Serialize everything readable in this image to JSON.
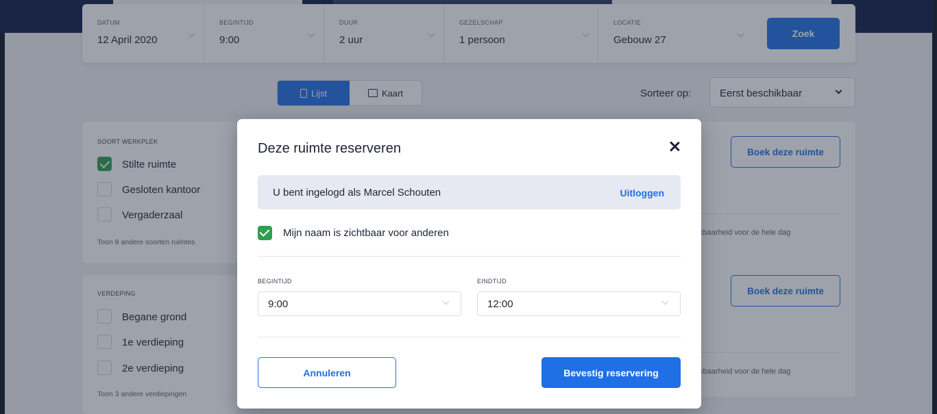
{
  "search": {
    "fields": [
      {
        "label": "DATUM",
        "value": "12 April 2020"
      },
      {
        "label": "BEGINTIJD",
        "value": "9:00"
      },
      {
        "label": "DUUR",
        "value": "2 uur"
      },
      {
        "label": "GEZELSCHAP",
        "value": "1 persoon"
      },
      {
        "label": "LOCATIE",
        "value": "Gebouw 27"
      }
    ],
    "submit_label": "Zoek"
  },
  "view_toggle": {
    "list_label": "Lijst",
    "map_label": "Kaart"
  },
  "sort": {
    "label": "Sorteer op:",
    "value": "Eerst beschikbaar"
  },
  "filters": {
    "workplace": {
      "title": "SOORT WERKPLEK",
      "items": [
        {
          "label": "Stilte ruimte",
          "checked": true
        },
        {
          "label": "Gesloten kantoor",
          "checked": false
        },
        {
          "label": "Vergaderzaal",
          "checked": false
        }
      ],
      "more": "Toon 8 andere soorten ruimtes"
    },
    "floor": {
      "title": "VERDEPING",
      "items": [
        {
          "label": "Begane grond",
          "checked": false
        },
        {
          "label": "1e verdieping",
          "checked": false
        },
        {
          "label": "2e verdieping",
          "checked": false
        }
      ],
      "more": "Toon 3 andere verdiepingen"
    }
  },
  "results": [
    {
      "book_label": "Boek deze ruimte",
      "availability": "kbaarheid voor de hele dag"
    },
    {
      "book_label": "Boek deze ruimte",
      "availability": "kbaarheid voor de hele dag"
    }
  ],
  "modal": {
    "title": "Deze ruimte reserveren",
    "login_text": "U bent ingelogd als Marcel Schouten",
    "logout_label": "Uitloggen",
    "visibility_label": "Mijn naam is zichtbaar voor anderen",
    "visibility_checked": true,
    "start": {
      "label": "BEGINTIJD",
      "value": "9:00"
    },
    "end": {
      "label": "EINDTIJD",
      "value": "12:00"
    },
    "cancel_label": "Annuleren",
    "confirm_label": "Bevestig reservering"
  },
  "colors": {
    "accent": "#1f6fe5",
    "check": "#2f9e52",
    "header": "#0f1d4a"
  }
}
